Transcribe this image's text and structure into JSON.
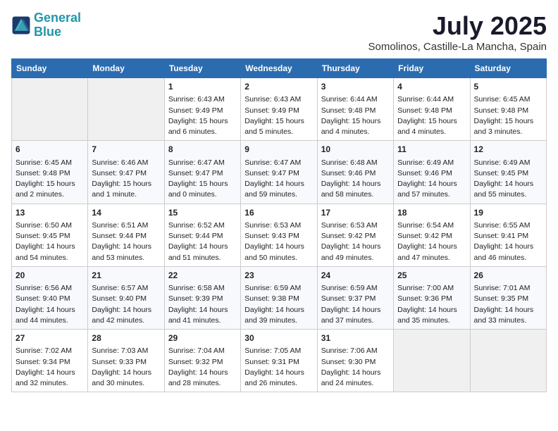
{
  "header": {
    "logo_line1": "General",
    "logo_line2": "Blue",
    "title": "July 2025",
    "subtitle": "Somolinos, Castille-La Mancha, Spain"
  },
  "days_of_week": [
    "Sunday",
    "Monday",
    "Tuesday",
    "Wednesday",
    "Thursday",
    "Friday",
    "Saturday"
  ],
  "weeks": [
    [
      {
        "day": "",
        "info": ""
      },
      {
        "day": "",
        "info": ""
      },
      {
        "day": "1",
        "info": "Sunrise: 6:43 AM\nSunset: 9:49 PM\nDaylight: 15 hours\nand 6 minutes."
      },
      {
        "day": "2",
        "info": "Sunrise: 6:43 AM\nSunset: 9:49 PM\nDaylight: 15 hours\nand 5 minutes."
      },
      {
        "day": "3",
        "info": "Sunrise: 6:44 AM\nSunset: 9:48 PM\nDaylight: 15 hours\nand 4 minutes."
      },
      {
        "day": "4",
        "info": "Sunrise: 6:44 AM\nSunset: 9:48 PM\nDaylight: 15 hours\nand 4 minutes."
      },
      {
        "day": "5",
        "info": "Sunrise: 6:45 AM\nSunset: 9:48 PM\nDaylight: 15 hours\nand 3 minutes."
      }
    ],
    [
      {
        "day": "6",
        "info": "Sunrise: 6:45 AM\nSunset: 9:48 PM\nDaylight: 15 hours\nand 2 minutes."
      },
      {
        "day": "7",
        "info": "Sunrise: 6:46 AM\nSunset: 9:47 PM\nDaylight: 15 hours\nand 1 minute."
      },
      {
        "day": "8",
        "info": "Sunrise: 6:47 AM\nSunset: 9:47 PM\nDaylight: 15 hours\nand 0 minutes."
      },
      {
        "day": "9",
        "info": "Sunrise: 6:47 AM\nSunset: 9:47 PM\nDaylight: 14 hours\nand 59 minutes."
      },
      {
        "day": "10",
        "info": "Sunrise: 6:48 AM\nSunset: 9:46 PM\nDaylight: 14 hours\nand 58 minutes."
      },
      {
        "day": "11",
        "info": "Sunrise: 6:49 AM\nSunset: 9:46 PM\nDaylight: 14 hours\nand 57 minutes."
      },
      {
        "day": "12",
        "info": "Sunrise: 6:49 AM\nSunset: 9:45 PM\nDaylight: 14 hours\nand 55 minutes."
      }
    ],
    [
      {
        "day": "13",
        "info": "Sunrise: 6:50 AM\nSunset: 9:45 PM\nDaylight: 14 hours\nand 54 minutes."
      },
      {
        "day": "14",
        "info": "Sunrise: 6:51 AM\nSunset: 9:44 PM\nDaylight: 14 hours\nand 53 minutes."
      },
      {
        "day": "15",
        "info": "Sunrise: 6:52 AM\nSunset: 9:44 PM\nDaylight: 14 hours\nand 51 minutes."
      },
      {
        "day": "16",
        "info": "Sunrise: 6:53 AM\nSunset: 9:43 PM\nDaylight: 14 hours\nand 50 minutes."
      },
      {
        "day": "17",
        "info": "Sunrise: 6:53 AM\nSunset: 9:42 PM\nDaylight: 14 hours\nand 49 minutes."
      },
      {
        "day": "18",
        "info": "Sunrise: 6:54 AM\nSunset: 9:42 PM\nDaylight: 14 hours\nand 47 minutes."
      },
      {
        "day": "19",
        "info": "Sunrise: 6:55 AM\nSunset: 9:41 PM\nDaylight: 14 hours\nand 46 minutes."
      }
    ],
    [
      {
        "day": "20",
        "info": "Sunrise: 6:56 AM\nSunset: 9:40 PM\nDaylight: 14 hours\nand 44 minutes."
      },
      {
        "day": "21",
        "info": "Sunrise: 6:57 AM\nSunset: 9:40 PM\nDaylight: 14 hours\nand 42 minutes."
      },
      {
        "day": "22",
        "info": "Sunrise: 6:58 AM\nSunset: 9:39 PM\nDaylight: 14 hours\nand 41 minutes."
      },
      {
        "day": "23",
        "info": "Sunrise: 6:59 AM\nSunset: 9:38 PM\nDaylight: 14 hours\nand 39 minutes."
      },
      {
        "day": "24",
        "info": "Sunrise: 6:59 AM\nSunset: 9:37 PM\nDaylight: 14 hours\nand 37 minutes."
      },
      {
        "day": "25",
        "info": "Sunrise: 7:00 AM\nSunset: 9:36 PM\nDaylight: 14 hours\nand 35 minutes."
      },
      {
        "day": "26",
        "info": "Sunrise: 7:01 AM\nSunset: 9:35 PM\nDaylight: 14 hours\nand 33 minutes."
      }
    ],
    [
      {
        "day": "27",
        "info": "Sunrise: 7:02 AM\nSunset: 9:34 PM\nDaylight: 14 hours\nand 32 minutes."
      },
      {
        "day": "28",
        "info": "Sunrise: 7:03 AM\nSunset: 9:33 PM\nDaylight: 14 hours\nand 30 minutes."
      },
      {
        "day": "29",
        "info": "Sunrise: 7:04 AM\nSunset: 9:32 PM\nDaylight: 14 hours\nand 28 minutes."
      },
      {
        "day": "30",
        "info": "Sunrise: 7:05 AM\nSunset: 9:31 PM\nDaylight: 14 hours\nand 26 minutes."
      },
      {
        "day": "31",
        "info": "Sunrise: 7:06 AM\nSunset: 9:30 PM\nDaylight: 14 hours\nand 24 minutes."
      },
      {
        "day": "",
        "info": ""
      },
      {
        "day": "",
        "info": ""
      }
    ]
  ]
}
